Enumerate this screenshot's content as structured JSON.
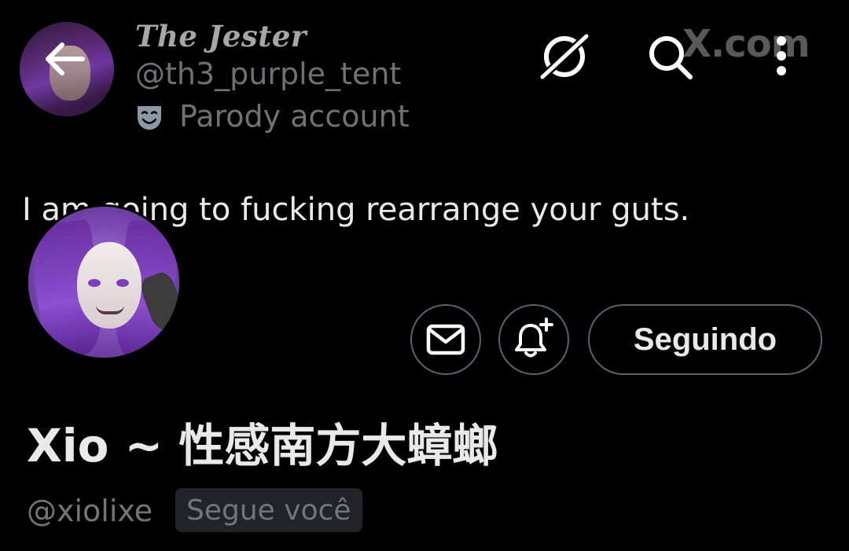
{
  "quoted_account": {
    "display_name": "The Jester",
    "handle": "@th3_purple_tent",
    "label": "Parody account",
    "label_icon": "theater-mask-icon"
  },
  "header": {
    "icons": [
      "back-arrow-icon",
      "grok-icon",
      "search-icon",
      "more-vert-icon"
    ],
    "watermark": "X.com"
  },
  "tweet": {
    "text": "I am going to fucking rearrange your guts."
  },
  "profile": {
    "display_name": "Xio ~ 性感南方大蟑螂",
    "handle": "@xiolixe",
    "follows_you_badge": "Segue você",
    "follow_button_label": "Seguindo",
    "message_icon": "envelope-icon",
    "notify_icon": "bell-plus-icon"
  },
  "colors": {
    "background": "#000000",
    "text_primary": "#e7e9ea",
    "text_secondary": "#71767b",
    "border": "#536471",
    "badge_bg": "#202327",
    "avatar_accent": "#8b5cc4"
  }
}
